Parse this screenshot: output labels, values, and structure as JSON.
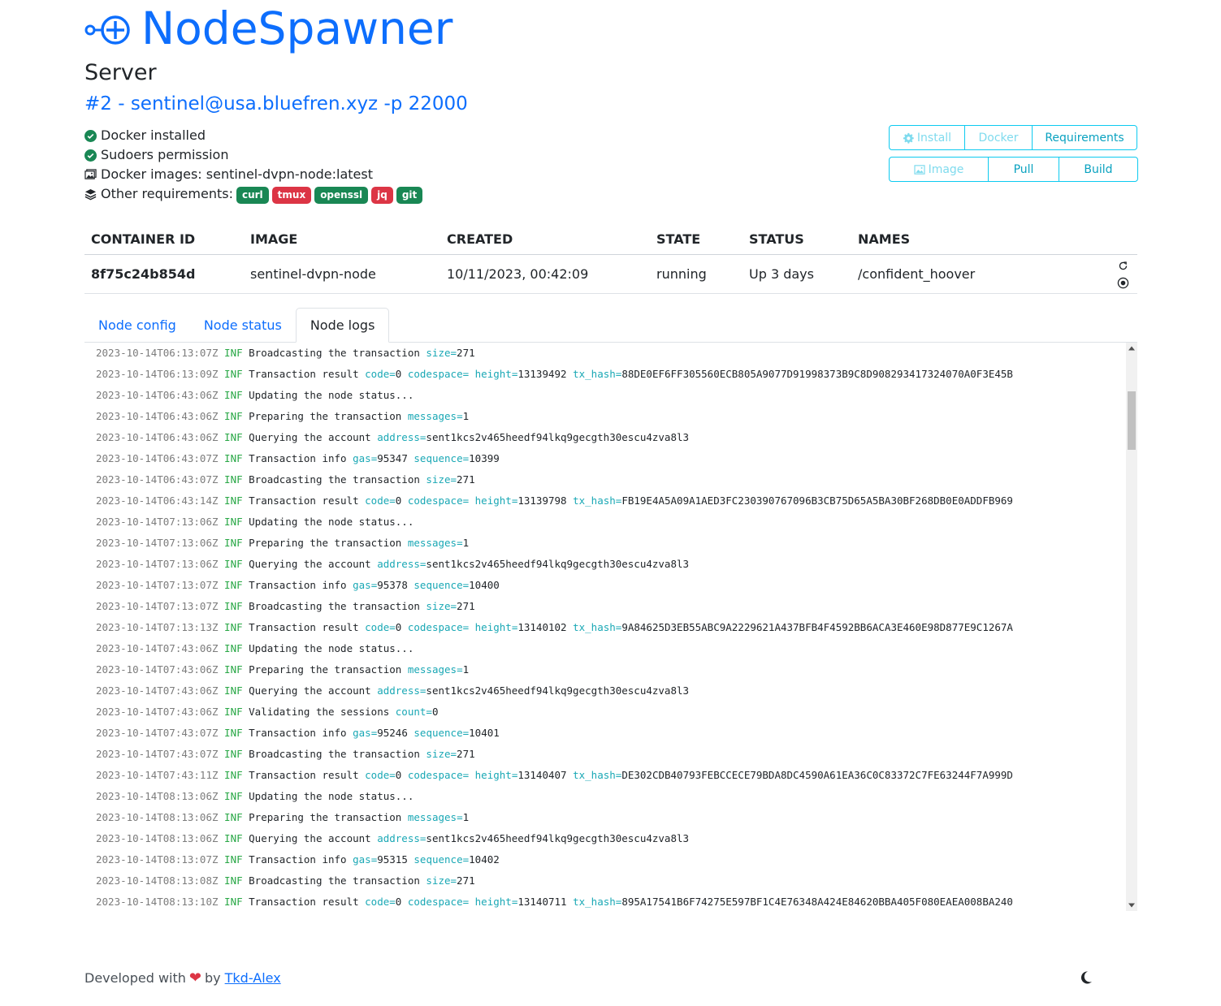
{
  "brand": {
    "title": "NodeSpawner"
  },
  "section_title": "Server",
  "server": {
    "label": "#2 - sentinel@usa.bluefren.xyz -p 22000"
  },
  "checks": [
    {
      "icon": "check-circle-icon",
      "text": "Docker installed"
    },
    {
      "icon": "check-circle-icon",
      "text": "Sudoers permission"
    },
    {
      "icon": "images-icon",
      "text": "Docker images: sentinel-dvpn-node:latest"
    },
    {
      "icon": "layers-icon",
      "text": "Other requirements:"
    }
  ],
  "requirements": [
    {
      "name": "curl",
      "status": "ok"
    },
    {
      "name": "tmux",
      "status": "bad"
    },
    {
      "name": "openssl",
      "status": "ok"
    },
    {
      "name": "jq",
      "status": "bad"
    },
    {
      "name": "git",
      "status": "ok"
    }
  ],
  "buttons": {
    "install": "Install",
    "docker": "Docker",
    "requirements": "Requirements",
    "image": "Image",
    "pull": "Pull",
    "build": "Build"
  },
  "table": {
    "headers": [
      "CONTAINER ID",
      "IMAGE",
      "CREATED",
      "STATE",
      "STATUS",
      "NAMES"
    ],
    "row": {
      "container_id": "8f75c24b854d",
      "image": "sentinel-dvpn-node",
      "created": "10/11/2023, 00:42:09",
      "state": "running",
      "status": "Up 3 days",
      "names": "/confident_hoover"
    }
  },
  "tabs": [
    "Node config",
    "Node status",
    "Node logs"
  ],
  "active_tab": "Node logs",
  "logs": [
    {
      "ts": "2023-10-14T06:13:07Z",
      "lvl": "INF",
      "msg": "Broadcasting the transaction",
      "kv": [
        [
          "size",
          "271"
        ]
      ]
    },
    {
      "ts": "2023-10-14T06:13:09Z",
      "lvl": "INF",
      "msg": "Transaction result",
      "kv": [
        [
          "code",
          "0"
        ],
        [
          "codespace",
          ""
        ],
        [
          "height",
          "13139492"
        ],
        [
          "tx_hash",
          "88DE0EF6FF305560ECB805A9077D91998373B9C8D908293417324070A0F3E45B"
        ]
      ]
    },
    {
      "ts": "2023-10-14T06:43:06Z",
      "lvl": "INF",
      "msg": "Updating the node status...",
      "kv": []
    },
    {
      "ts": "2023-10-14T06:43:06Z",
      "lvl": "INF",
      "msg": "Preparing the transaction",
      "kv": [
        [
          "messages",
          "1"
        ]
      ]
    },
    {
      "ts": "2023-10-14T06:43:06Z",
      "lvl": "INF",
      "msg": "Querying the account",
      "kv": [
        [
          "address",
          "sent1kcs2v465heedf94lkq9gecgth30escu4zva8l3"
        ]
      ]
    },
    {
      "ts": "2023-10-14T06:43:07Z",
      "lvl": "INF",
      "msg": "Transaction info",
      "kv": [
        [
          "gas",
          "95347"
        ],
        [
          "sequence",
          "10399"
        ]
      ]
    },
    {
      "ts": "2023-10-14T06:43:07Z",
      "lvl": "INF",
      "msg": "Broadcasting the transaction",
      "kv": [
        [
          "size",
          "271"
        ]
      ]
    },
    {
      "ts": "2023-10-14T06:43:14Z",
      "lvl": "INF",
      "msg": "Transaction result",
      "kv": [
        [
          "code",
          "0"
        ],
        [
          "codespace",
          ""
        ],
        [
          "height",
          "13139798"
        ],
        [
          "tx_hash",
          "FB19E4A5A09A1AED3FC230390767096B3CB75D65A5BA30BF268DB0E0ADDFB969"
        ]
      ]
    },
    {
      "ts": "2023-10-14T07:13:06Z",
      "lvl": "INF",
      "msg": "Updating the node status...",
      "kv": []
    },
    {
      "ts": "2023-10-14T07:13:06Z",
      "lvl": "INF",
      "msg": "Preparing the transaction",
      "kv": [
        [
          "messages",
          "1"
        ]
      ]
    },
    {
      "ts": "2023-10-14T07:13:06Z",
      "lvl": "INF",
      "msg": "Querying the account",
      "kv": [
        [
          "address",
          "sent1kcs2v465heedf94lkq9gecgth30escu4zva8l3"
        ]
      ]
    },
    {
      "ts": "2023-10-14T07:13:07Z",
      "lvl": "INF",
      "msg": "Transaction info",
      "kv": [
        [
          "gas",
          "95378"
        ],
        [
          "sequence",
          "10400"
        ]
      ]
    },
    {
      "ts": "2023-10-14T07:13:07Z",
      "lvl": "INF",
      "msg": "Broadcasting the transaction",
      "kv": [
        [
          "size",
          "271"
        ]
      ]
    },
    {
      "ts": "2023-10-14T07:13:13Z",
      "lvl": "INF",
      "msg": "Transaction result",
      "kv": [
        [
          "code",
          "0"
        ],
        [
          "codespace",
          ""
        ],
        [
          "height",
          "13140102"
        ],
        [
          "tx_hash",
          "9A84625D3EB55ABC9A2229621A437BFB4F4592BB6ACA3E460E98D877E9C1267A"
        ]
      ]
    },
    {
      "ts": "2023-10-14T07:43:06Z",
      "lvl": "INF",
      "msg": "Updating the node status...",
      "kv": []
    },
    {
      "ts": "2023-10-14T07:43:06Z",
      "lvl": "INF",
      "msg": "Preparing the transaction",
      "kv": [
        [
          "messages",
          "1"
        ]
      ]
    },
    {
      "ts": "2023-10-14T07:43:06Z",
      "lvl": "INF",
      "msg": "Querying the account",
      "kv": [
        [
          "address",
          "sent1kcs2v465heedf94lkq9gecgth30escu4zva8l3"
        ]
      ]
    },
    {
      "ts": "2023-10-14T07:43:06Z",
      "lvl": "INF",
      "msg": "Validating the sessions",
      "kv": [
        [
          "count",
          "0"
        ]
      ]
    },
    {
      "ts": "2023-10-14T07:43:07Z",
      "lvl": "INF",
      "msg": "Transaction info",
      "kv": [
        [
          "gas",
          "95246"
        ],
        [
          "sequence",
          "10401"
        ]
      ]
    },
    {
      "ts": "2023-10-14T07:43:07Z",
      "lvl": "INF",
      "msg": "Broadcasting the transaction",
      "kv": [
        [
          "size",
          "271"
        ]
      ]
    },
    {
      "ts": "2023-10-14T07:43:11Z",
      "lvl": "INF",
      "msg": "Transaction result",
      "kv": [
        [
          "code",
          "0"
        ],
        [
          "codespace",
          ""
        ],
        [
          "height",
          "13140407"
        ],
        [
          "tx_hash",
          "DE302CDB40793FEBCCECE79BDA8DC4590A61EA36C0C83372C7FE63244F7A999D"
        ]
      ]
    },
    {
      "ts": "2023-10-14T08:13:06Z",
      "lvl": "INF",
      "msg": "Updating the node status...",
      "kv": []
    },
    {
      "ts": "2023-10-14T08:13:06Z",
      "lvl": "INF",
      "msg": "Preparing the transaction",
      "kv": [
        [
          "messages",
          "1"
        ]
      ]
    },
    {
      "ts": "2023-10-14T08:13:06Z",
      "lvl": "INF",
      "msg": "Querying the account",
      "kv": [
        [
          "address",
          "sent1kcs2v465heedf94lkq9gecgth30escu4zva8l3"
        ]
      ]
    },
    {
      "ts": "2023-10-14T08:13:07Z",
      "lvl": "INF",
      "msg": "Transaction info",
      "kv": [
        [
          "gas",
          "95315"
        ],
        [
          "sequence",
          "10402"
        ]
      ]
    },
    {
      "ts": "2023-10-14T08:13:08Z",
      "lvl": "INF",
      "msg": "Broadcasting the transaction",
      "kv": [
        [
          "size",
          "271"
        ]
      ]
    },
    {
      "ts": "2023-10-14T08:13:10Z",
      "lvl": "INF",
      "msg": "Transaction result",
      "kv": [
        [
          "code",
          "0"
        ],
        [
          "codespace",
          ""
        ],
        [
          "height",
          "13140711"
        ],
        [
          "tx_hash",
          "895A17541B6F74275E597BF1C4E76348A424E84620BBA405F080EAEA008BA240"
        ]
      ]
    }
  ],
  "footer": {
    "prefix": "Developed with",
    "heart": "❤",
    "by": "by",
    "author": "Tkd-Alex"
  },
  "colors": {
    "primary": "#0d6efd",
    "success": "#198754",
    "danger": "#dc3545",
    "info": "#0dcaf0",
    "log_key": "#1aa8b5",
    "log_level": "#28a745"
  }
}
